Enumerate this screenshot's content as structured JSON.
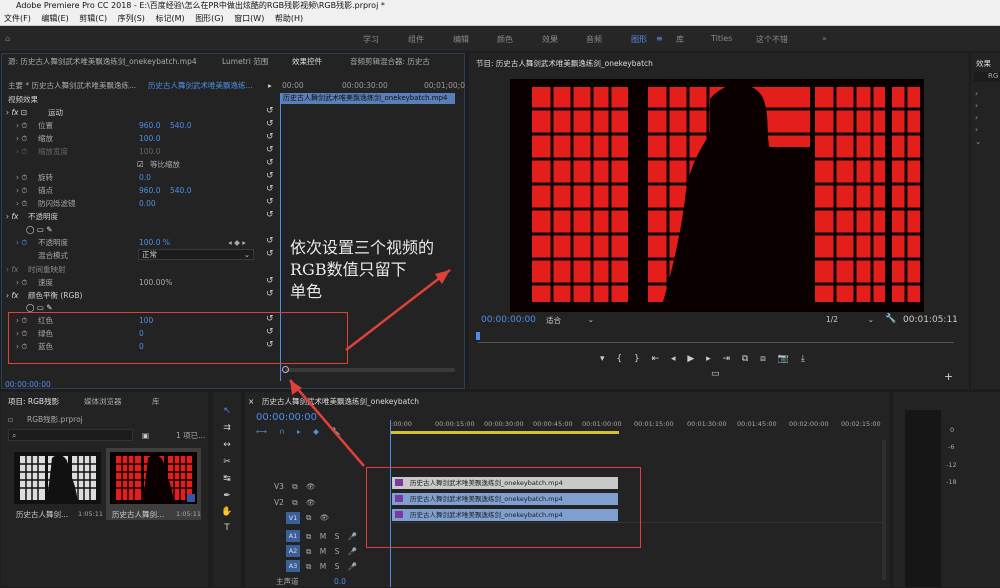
{
  "title": "Adobe Premiere Pro CC 2018 - E:\\百度经验\\怎么在PR中做出炫酷的RGB残影视频\\RGB残影.prproj *",
  "menu": [
    "文件(F)",
    "编辑(E)",
    "剪辑(C)",
    "序列(S)",
    "标记(M)",
    "图形(G)",
    "窗口(W)",
    "帮助(H)"
  ],
  "workspaces": [
    "学习",
    "组件",
    "编辑",
    "颜色",
    "效果",
    "音频",
    "图形",
    "库",
    "Titles",
    "这个不错"
  ],
  "source": {
    "tabs": [
      "源: 历史古人舞剑武术唯美飘逸练剑_onekeybatch.mp4",
      "Lumetri 范围",
      "效果控件",
      "音频剪辑混合器: 历史古"
    ],
    "master": "主要 * 历史古人舞剑武术唯美飘逸练...",
    "clipref": "历史古人舞剑武术唯美飘逸练...",
    "section": "视频效果",
    "ruler": [
      "00:00",
      "00:00:30:00",
      "00;01;00;0"
    ],
    "clipname": "历史古人舞剑武术唯美飘逸练剑_onekeybatch.mp4",
    "motion": "运动",
    "position": {
      "label": "位置",
      "x": "960.0",
      "y": "540.0"
    },
    "scale": {
      "label": "缩放",
      "value": "100.0"
    },
    "scale_width": {
      "label": "缩放宽度",
      "value": "100.0"
    },
    "uniform": "等比缩放",
    "rotation": {
      "label": "旋转",
      "value": "0.0"
    },
    "anchor": {
      "label": "锚点",
      "x": "960.0",
      "y": "540.0"
    },
    "antiflicker": {
      "label": "防闪烁滤镜",
      "value": "0.00"
    },
    "opacity_group": "不透明度",
    "opacity": {
      "label": "不透明度",
      "value": "100.0 %"
    },
    "blend": {
      "label": "混合模式",
      "value": "正常"
    },
    "timeremap": "时间重映射",
    "speed": {
      "label": "速度",
      "value": "100.00%"
    },
    "colorbalance": "颜色平衡 (RGB)",
    "red": {
      "label": "红色",
      "value": "100"
    },
    "green": {
      "label": "绿色",
      "value": "0"
    },
    "blue": {
      "label": "蓝色",
      "value": "0"
    },
    "timecode": "00:00:00:00"
  },
  "program": {
    "tab": "节目: 历史古人舞剑武术唯美飘逸练剑_onekeybatch",
    "timecode": "00:00:00:00",
    "fit": "适合",
    "quality": "1/2",
    "duration": "00:01:05:11"
  },
  "right_panel": {
    "tab": "效果",
    "search": "RG"
  },
  "project": {
    "tabs": [
      "项目: RGB残影",
      "媒体浏览器",
      "库"
    ],
    "file": "RGB残影.prproj",
    "count": "1 项已...",
    "items": [
      {
        "name": "历史古人舞剑...",
        "duration": "1:05:11"
      },
      {
        "name": "历史古人舞剑...",
        "duration": "1:05:11"
      }
    ]
  },
  "timeline": {
    "tab": "历史古人舞剑武术唯美飘逸练剑_onekeybatch",
    "timecode": "00:00:00:00",
    "ruler": [
      ":00:00",
      "00:00:15:00",
      "00:00:30:00",
      "00:00:45:00",
      "00:01:00:00",
      "00:01:15:00",
      "00:01:30:00",
      "00:01:45:00",
      "00:02:00:00",
      "00:02:15:00"
    ],
    "tracks_v": [
      "V3",
      "V2",
      "V1"
    ],
    "tracks_a": [
      "A1",
      "A2",
      "A3"
    ],
    "master": {
      "label": "主声道",
      "value": "0.0"
    },
    "clips": [
      "历史古人舞剑武术唯美飘逸练剑_onekeybatch.mp4",
      "历史古人舞剑武术唯美飘逸练剑_onekeybatch.mp4",
      "历史古人舞剑武术唯美飘逸练剑_onekeybatch.mp4"
    ]
  },
  "meter": [
    "0",
    "-6",
    "-12",
    "-18"
  ],
  "annotation": [
    "依次设置三个视频的",
    "RGB数值只留下",
    "单色"
  ]
}
